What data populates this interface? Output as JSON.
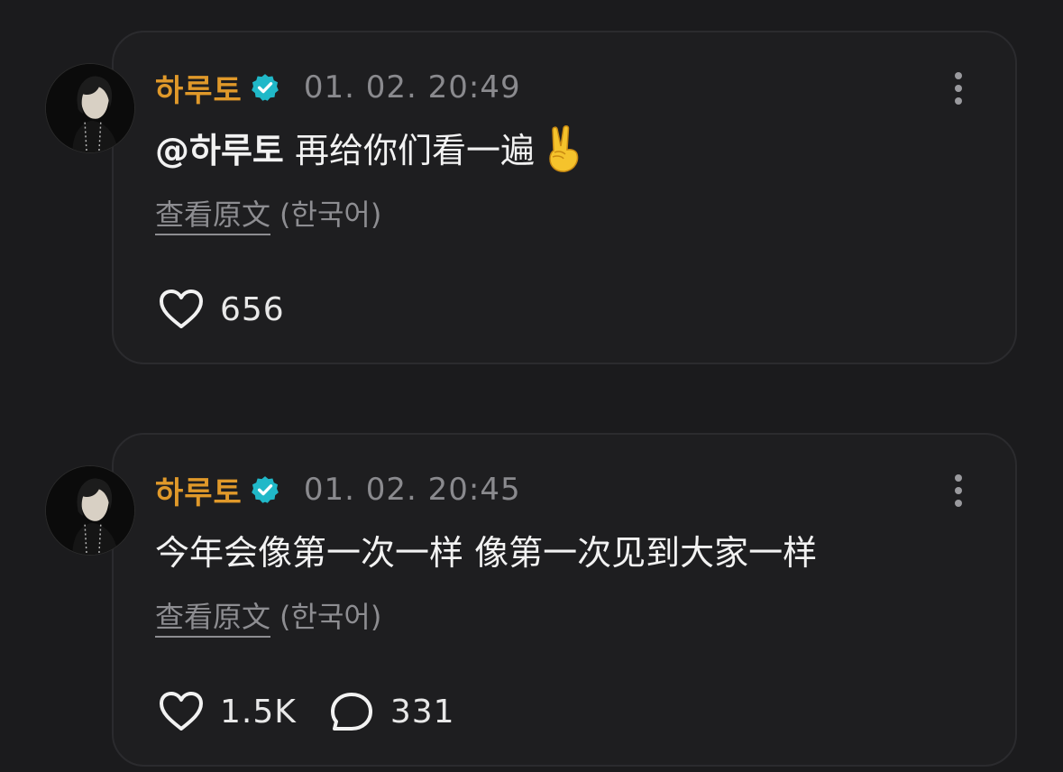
{
  "posts": [
    {
      "username": "하루토",
      "timestamp": "01. 02. 20:49",
      "mention": "@하루토",
      "text": " 再给你们看一遍",
      "emoji": "victory-hand",
      "translate_link": "查看原文",
      "translate_lang": "(한국어)",
      "likes": "656"
    },
    {
      "username": "하루토",
      "timestamp": "01. 02. 20:45",
      "text": "今年会像第一次一样 像第一次见到大家一样",
      "translate_link": "查看原文",
      "translate_lang": "(한국어)",
      "likes": "1.5K",
      "comments": "331"
    }
  ],
  "colors": {
    "background": "#1b1b1d",
    "card": "#1e1e20",
    "username": "#e0992a",
    "verified": "#20b8c8",
    "muted": "#8a8a8e",
    "text": "#f2f2f2"
  },
  "icons": [
    "verified-badge-icon",
    "more-options-icon",
    "heart-icon",
    "comment-icon",
    "victory-hand-emoji"
  ]
}
